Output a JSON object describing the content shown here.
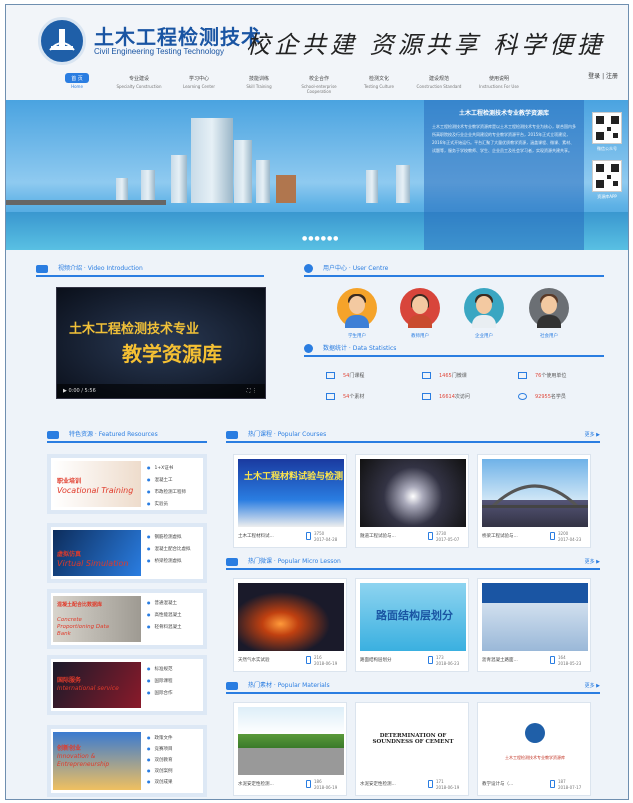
{
  "header": {
    "brand_cn": "土木工程检测技术",
    "brand_en": "Civil Engineering Testing Technology",
    "slogan": "校企共建  资源共享  科学便捷",
    "login": "登录 | 注册"
  },
  "nav": [
    {
      "cn": "首 页",
      "en": "Home"
    },
    {
      "cn": "专业建设",
      "en": "Specialty Construction"
    },
    {
      "cn": "学习中心",
      "en": "Learning Center"
    },
    {
      "cn": "技能训练",
      "en": "Skill Training"
    },
    {
      "cn": "校企合作",
      "en": "School-enterprise Cooperation"
    },
    {
      "cn": "检测文化",
      "en": "Testing Culture"
    },
    {
      "cn": "建设规范",
      "en": "Construction Standard"
    },
    {
      "cn": "使用说明",
      "en": "Instructions For Use"
    }
  ],
  "banner": {
    "title": "土木工程检测技术专业教学资源库",
    "body": "土木工程检测技术专业教学资源库是以土木工程检测技术专业为核心，联合国内多所高职院校及行业企业共同建设的专业教学资源平台，2015年正式立项建设，2016年正式开始运行。平台汇聚了大量优质教学资源，涵盖课程、微课、素材、试题等，服务于学校教师、学生、企业员工及社会学习者，实现资源共建共享。",
    "qr1": "微信公众号",
    "qr2": "资源库APP"
  },
  "video": {
    "section": "视频介绍 · Video Introduction",
    "title1": "土木工程检测技术专业",
    "title2": "教学资源库",
    "time": "0:00 / 5:56"
  },
  "users": {
    "section": "用户中心 · User Centre",
    "items": [
      {
        "label": "学生用户"
      },
      {
        "label": "教师用户"
      },
      {
        "label": "企业用户"
      },
      {
        "label": "社会用户"
      }
    ]
  },
  "stats": {
    "section": "数据统计 · Data Statistics",
    "items": [
      {
        "num": "54",
        "text": "门课程"
      },
      {
        "num": "1465",
        "text": "门微课"
      },
      {
        "num": "76",
        "text": "个使用单位"
      },
      {
        "num": "54",
        "text": "个素材"
      },
      {
        "num": "16614",
        "text": "次访问"
      },
      {
        "num": "92955",
        "text": "名学员"
      }
    ]
  },
  "featured": {
    "section": "特色资源 · Featured Resources",
    "items": [
      {
        "t1": "职业培训",
        "t2": "Vocational Training",
        "list": [
          "1+X证书",
          "混凝土工",
          "市政检测工程师",
          "实验员"
        ]
      },
      {
        "t1": "虚拟仿真",
        "t2": "Virtual Simulation",
        "list": [
          "钢筋检测虚拟",
          "混凝土配合比虚拟",
          "桥梁检测虚拟"
        ]
      },
      {
        "t1": "混凝土配合比数据库",
        "t2": "Concrete Proportioning Data Bank",
        "list": [
          "普通混凝土",
          "高性能混凝土",
          "轻骨料混凝土"
        ]
      },
      {
        "t1": "国际服务",
        "t2": "International service",
        "list": [
          "标准规范",
          "国际课程",
          "国际合作"
        ]
      },
      {
        "t1": "创新创业",
        "t2": "Innovation & Entrepreneurship",
        "list": [
          "政策文件",
          "竞赛项目",
          "双创教育",
          "双创案例",
          "双创成果"
        ]
      }
    ]
  },
  "courses": {
    "section": "热门课程 · Popular Courses",
    "more": "更多 ▶",
    "items": [
      {
        "cap": "土木工程材料试...",
        "views": "3750",
        "date": "2017-04-28",
        "title": "土木工程材料试验与检测"
      },
      {
        "cap": "隧道工程试验与...",
        "views": "3730",
        "date": "2017-05-07"
      },
      {
        "cap": "桥梁工程试验与...",
        "views": "3200",
        "date": "2017-04-23"
      }
    ]
  },
  "micro": {
    "section": "热门微课 · Popular Micro Lesson",
    "more": "更多 ▶",
    "items": [
      {
        "cap": "天然气水实试验",
        "views": "216",
        "date": "2018-06-19"
      },
      {
        "cap": "路面结构层划分",
        "views": "173",
        "date": "2018-06-23",
        "title": "路面结构层划分"
      },
      {
        "cap": "沥青混凝土路面...",
        "views": "164",
        "date": "2018-05-23"
      }
    ]
  },
  "materials": {
    "section": "热门素材 · Popular Materials",
    "more": "更多 ▶",
    "items": [
      {
        "cap": "水泥安定性检测...",
        "views": "186",
        "date": "2018-06-19"
      },
      {
        "cap": "水泥安定性检测...",
        "views": "171",
        "date": "2018-06-19",
        "title": "DETERMINATION OF SOUNDNESS OF CEMENT"
      },
      {
        "cap": "教学设计与（...",
        "views": "187",
        "date": "2018-07-17",
        "title": "土木工程检测技术专业教学资源库"
      }
    ]
  },
  "colors": {
    "accent": "#2a7de1",
    "red": "#e03a2a"
  }
}
